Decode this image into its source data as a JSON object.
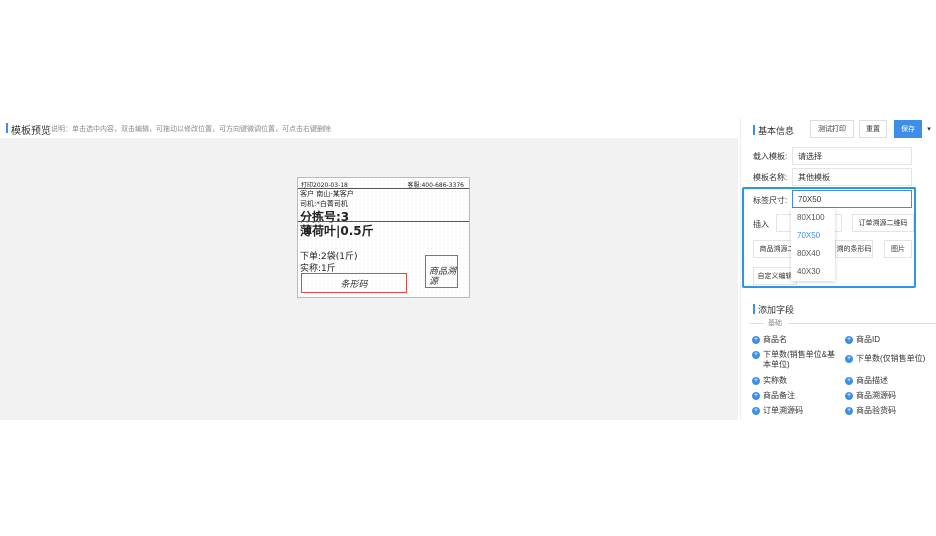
{
  "preview": {
    "title": "模板预览",
    "description": "说明：单击选中内容，双击编辑，可拖动以修改位置，可方向键微调位置，可点击右键删除"
  },
  "label": {
    "print_date": "打印2020-03-18",
    "hotline": "客服:400-686-3376",
    "customer": "客户 南山-某客户",
    "driver": "司机:*白菁司机",
    "sort_no": "分拣号:3",
    "product": "薄荷叶|0.5斤",
    "order_qty": "下单:2袋(1斤)",
    "actual": "实称:1斤",
    "barcode": "条形码",
    "trace_line1": "商品溯",
    "trace_line2": "源"
  },
  "panel": {
    "basic_info_title": "基本信息",
    "test_print": "测试打印",
    "reset": "重置",
    "save": "保存",
    "load_template_label": "载入模板:",
    "load_template_value": "请选择",
    "template_name_label": "模板名称:",
    "template_name_value": "其他模板",
    "label_size_label": "标签尺寸:",
    "label_size_value": "70X50",
    "insert_label": "插入",
    "chips": {
      "text": "文",
      "order_trace_qr": "订单溯源二维码",
      "product_trace": "商品溯源二",
      "tracing_barcode": "溯的条形码",
      "image": "图片",
      "custom": "自定义编辑"
    },
    "size_options": [
      "80X100",
      "70X50",
      "80X40",
      "40X30"
    ],
    "size_selected": "70X50",
    "add_field_title": "添加字段",
    "basic_group": "基础",
    "fields": {
      "product_name": "商品名",
      "product_id": "商品ID",
      "order_qty_sale_base": "下单数(销售单位&基本单位)",
      "order_qty_sale_only": "下单数(仅销售单位)",
      "actual_qty": "实称数",
      "product_desc": "商品描述",
      "product_remark": "商品备注",
      "product_trace_code": "商品溯源码",
      "order_trace_code": "订单溯源码",
      "product_check_code": "商品验货码"
    }
  }
}
